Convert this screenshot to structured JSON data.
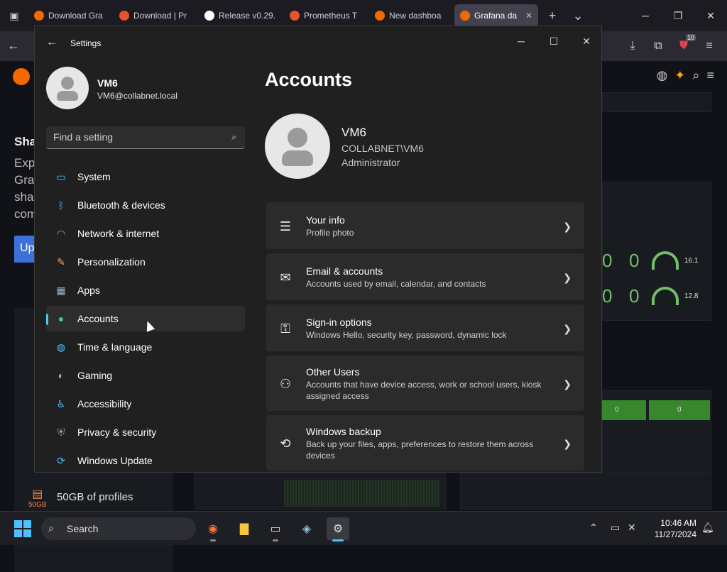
{
  "browser": {
    "tabs": [
      {
        "label": "Download Gra",
        "color": "#f46800",
        "active": false
      },
      {
        "label": "Download | Pr",
        "color": "#e6522c",
        "active": false
      },
      {
        "label": "Release v0.29.",
        "color": "#ffffff",
        "active": false
      },
      {
        "label": "Prometheus T",
        "color": "#e6522c",
        "active": false
      },
      {
        "label": "New dashboa",
        "color": "#f46800",
        "active": false
      },
      {
        "label": "Grafana da",
        "color": "#f46800",
        "active": true
      }
    ],
    "extension_badge": "10"
  },
  "grafana_bg": {
    "left_texts": [
      "Sha",
      "Exp",
      "Gra",
      "sha",
      "com",
      "Up"
    ],
    "stat_values": [
      "0",
      "0",
      "0",
      "0"
    ],
    "gauge_values": [
      "16.1",
      "12.8"
    ],
    "green_values": [
      "0",
      "0"
    ],
    "profiles_label": "50GB of profiles",
    "profiles_icon_text": "50GB"
  },
  "settings": {
    "window_title": "Settings",
    "user": {
      "name": "VM6",
      "email": "VM6@collabnet.local"
    },
    "search_placeholder": "Find a setting",
    "nav": [
      {
        "label": "System",
        "icon": "system-icon",
        "glyph": "▭",
        "color": "#4cc2ff"
      },
      {
        "label": "Bluetooth & devices",
        "icon": "bluetooth-icon",
        "glyph": "ᛒ",
        "color": "#4cc2ff"
      },
      {
        "label": "Network & internet",
        "icon": "wifi-icon",
        "glyph": "◠",
        "color": "#4cc2ff"
      },
      {
        "label": "Personalization",
        "icon": "brush-icon",
        "glyph": "✎",
        "color": "#f0a060"
      },
      {
        "label": "Apps",
        "icon": "apps-icon",
        "glyph": "▦",
        "color": "#a0b8d0"
      },
      {
        "label": "Accounts",
        "icon": "accounts-icon",
        "glyph": "●",
        "color": "#3cc8a8"
      },
      {
        "label": "Time & language",
        "icon": "globe-icon",
        "glyph": "◍",
        "color": "#4cc2ff"
      },
      {
        "label": "Gaming",
        "icon": "gamepad-icon",
        "glyph": "◐",
        "color": "#b0b0b0"
      },
      {
        "label": "Accessibility",
        "icon": "accessibility-icon",
        "glyph": "♿",
        "color": "#4cc2ff"
      },
      {
        "label": "Privacy & security",
        "icon": "shield-icon",
        "glyph": "⛨",
        "color": "#b0b0b0"
      },
      {
        "label": "Windows Update",
        "icon": "update-icon",
        "glyph": "⟳",
        "color": "#4cc2ff"
      }
    ],
    "active_nav": "Accounts",
    "page_title": "Accounts",
    "account": {
      "name": "VM6",
      "domain": "COLLABNET\\VM6",
      "role": "Administrator"
    },
    "cards": [
      {
        "title": "Your info",
        "desc": "Profile photo",
        "icon": "person-info-icon",
        "glyph": "☰"
      },
      {
        "title": "Email & accounts",
        "desc": "Accounts used by email, calendar, and contacts",
        "icon": "mail-icon",
        "glyph": "✉"
      },
      {
        "title": "Sign-in options",
        "desc": "Windows Hello, security key, password, dynamic lock",
        "icon": "key-icon",
        "glyph": "⚿"
      },
      {
        "title": "Other Users",
        "desc": "Accounts that have device access, work or school users, kiosk assigned access",
        "icon": "add-user-icon",
        "glyph": "⚇"
      },
      {
        "title": "Windows backup",
        "desc": "Back up your files, apps, preferences to restore them across devices",
        "icon": "backup-icon",
        "glyph": "⟲"
      }
    ]
  },
  "taskbar": {
    "search_label": "Search",
    "time": "10:46 AM",
    "date": "11/27/2024"
  }
}
